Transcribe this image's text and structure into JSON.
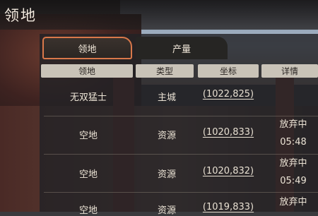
{
  "title": "领地",
  "tabs": [
    {
      "label": "领地",
      "active": true
    },
    {
      "label": "产量",
      "active": false
    }
  ],
  "columns": [
    "领地",
    "类型",
    "坐标",
    "详情"
  ],
  "rows": [
    {
      "name": "无双猛士",
      "type": "主城",
      "coord": "(1022,825)",
      "status": "",
      "time": ""
    },
    {
      "name": "空地",
      "type": "资源",
      "coord": "(1020,833)",
      "status": "放弃中",
      "time": "05:48"
    },
    {
      "name": "空地",
      "type": "资源",
      "coord": "(1020,832)",
      "status": "放弃中",
      "time": "05:49"
    },
    {
      "name": "空地",
      "type": "资源",
      "coord": "(1019,833)",
      "status": "放弃中",
      "time": ""
    }
  ],
  "colors": {
    "tab_border": "#d9784a",
    "header_bg": "#c9c3b8",
    "text": "#ece4d6"
  }
}
